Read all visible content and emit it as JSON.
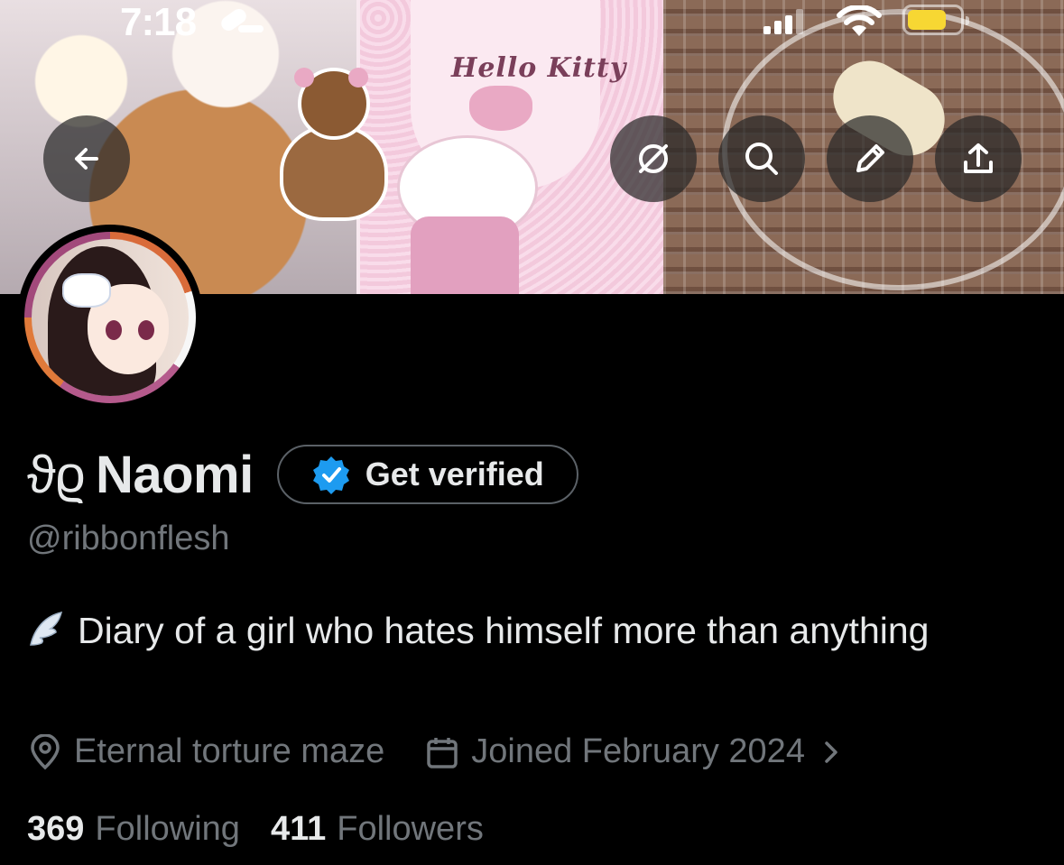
{
  "status_bar": {
    "time": "7:18",
    "battery_color": "#f7d733"
  },
  "banner": {
    "title": "Hello Kitty"
  },
  "header_buttons": {
    "back": "arrow-left-icon",
    "grok": "grok-icon",
    "search": "search-icon",
    "edit": "pencil-icon",
    "share": "share-icon"
  },
  "profile": {
    "name_prefix": "ϑϱ",
    "name": "Naomi",
    "get_verified_label": "Get verified",
    "handle": "@ribbonflesh",
    "bio": "Diary of a girl who hates himself more than anything",
    "location": "Eternal torture maze",
    "joined": "Joined February 2024",
    "following_count": "369",
    "following_label": "Following",
    "followers_count": "411",
    "followers_label": "Followers"
  },
  "colors": {
    "background": "#000000",
    "primary_text": "#e7e9ea",
    "secondary_text": "#71767b",
    "verified_blue": "#1d9bf0"
  }
}
